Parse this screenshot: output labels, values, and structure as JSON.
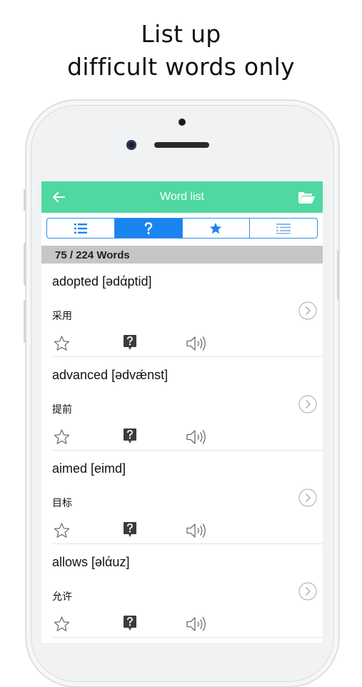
{
  "promo": {
    "line1": "List up",
    "line2": "difficult words only"
  },
  "appbar": {
    "title": "Word list",
    "back_icon": "back-arrow-icon",
    "folder_icon": "folder-open-icon"
  },
  "tabs": [
    {
      "name": "list-icon",
      "active": false
    },
    {
      "name": "question-icon",
      "active": true
    },
    {
      "name": "star-icon",
      "active": false
    },
    {
      "name": "checklist-icon",
      "active": false
    }
  ],
  "count": "75 / 224 Words",
  "words": [
    {
      "word": "adopted [ədάptid]",
      "meaning": "采用"
    },
    {
      "word": "advanced [ədvǽnst]",
      "meaning": "提前"
    },
    {
      "word": "aimed [eimd]",
      "meaning": "目标"
    },
    {
      "word": "allows [əlάuz]",
      "meaning": "允许"
    }
  ],
  "colors": {
    "appbar": "#4fd8a1",
    "tab_accent": "#1a84f0",
    "count_bar": "#c6c6c6"
  }
}
